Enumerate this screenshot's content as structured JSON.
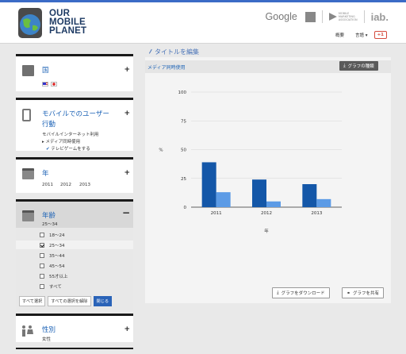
{
  "brand": {
    "line1": "OUR",
    "line2": "MOBILE",
    "line3": "PLANET"
  },
  "partners": {
    "google": "Google",
    "iab": "iab.",
    "mma_line1": "MOBILE",
    "mma_line2": "MARKETING",
    "mma_line3": "ASSOCIATION"
  },
  "nav": {
    "about": "概要",
    "language": "言語 ▾",
    "gplus": "+1"
  },
  "sidebar": {
    "country": {
      "title": "国"
    },
    "behavior": {
      "title_line1": "モバイルでのユーザー",
      "title_line2": "行動",
      "sub1": "モバイルインターネット利用",
      "sub2": "メディア同時使用",
      "sub3": "テレビゲームをする"
    },
    "year": {
      "title": "年",
      "years": [
        "2011",
        "2012",
        "2013"
      ]
    },
    "age": {
      "title": "年齢",
      "current": "25～34",
      "options": [
        {
          "label": "18～24",
          "checked": false
        },
        {
          "label": "25～34",
          "checked": true
        },
        {
          "label": "35～44",
          "checked": false
        },
        {
          "label": "45～54",
          "checked": false
        },
        {
          "label": "55才以上",
          "checked": false
        },
        {
          "label": "すべて",
          "checked": false
        }
      ],
      "btn_select_all": "すべて選択",
      "btn_clear_all": "すべての選択を解除",
      "btn_close": "閉じる"
    },
    "gender": {
      "title": "性別",
      "value": "女性"
    }
  },
  "main": {
    "edit_title": "タイトルを編集",
    "chart_title": "メディア同時使用",
    "chart_type_btn": "グラフの種類",
    "download_btn": "グラフをダウンロード",
    "share_btn": "グラフを共有"
  },
  "chart_data": {
    "type": "bar",
    "categories": [
      "2011",
      "2012",
      "2013"
    ],
    "series": [
      {
        "values": [
          39,
          24,
          20
        ],
        "color": "#1457a8"
      },
      {
        "values": [
          13,
          5,
          7
        ],
        "color": "#5c9be6"
      }
    ],
    "ylabel": "%",
    "xlabel": "年",
    "ylim": [
      0,
      100
    ],
    "yticks": [
      "0",
      "25",
      "50",
      "75",
      "100"
    ],
    "grid": true
  }
}
